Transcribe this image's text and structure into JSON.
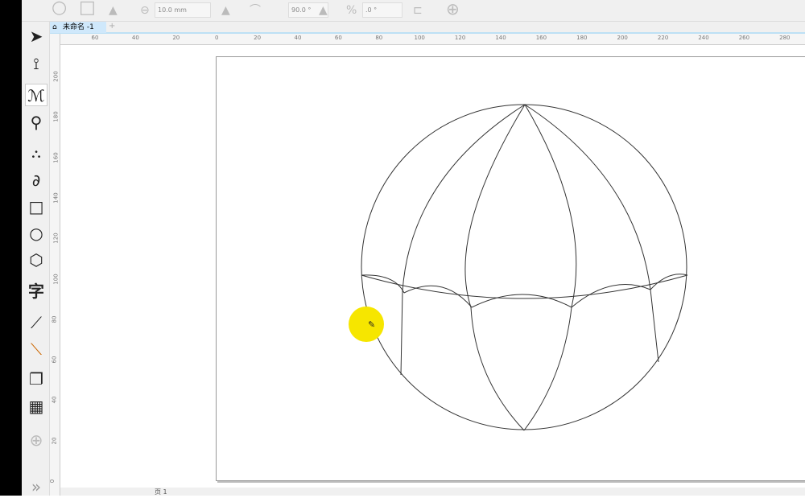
{
  "propbar": {
    "outline_width": "10.0 mm",
    "angle": "90.0 °",
    "rotation": ".0 °"
  },
  "document": {
    "tab_title": "未命名 -1"
  },
  "ruler": {
    "h_labels": [
      "60",
      "40",
      "20",
      "0",
      "20",
      "40",
      "60",
      "80",
      "100",
      "120",
      "140",
      "160",
      "180",
      "200",
      "220",
      "240",
      "260",
      "280"
    ],
    "v_labels": [
      "200",
      "180",
      "160",
      "140",
      "120",
      "100",
      "80",
      "60",
      "40",
      "20",
      "0"
    ]
  },
  "toolbox": {
    "text_tool": "字"
  },
  "statusbar": {
    "page_tab": "页 1"
  },
  "colors": {
    "highlight": "#f6e600"
  }
}
